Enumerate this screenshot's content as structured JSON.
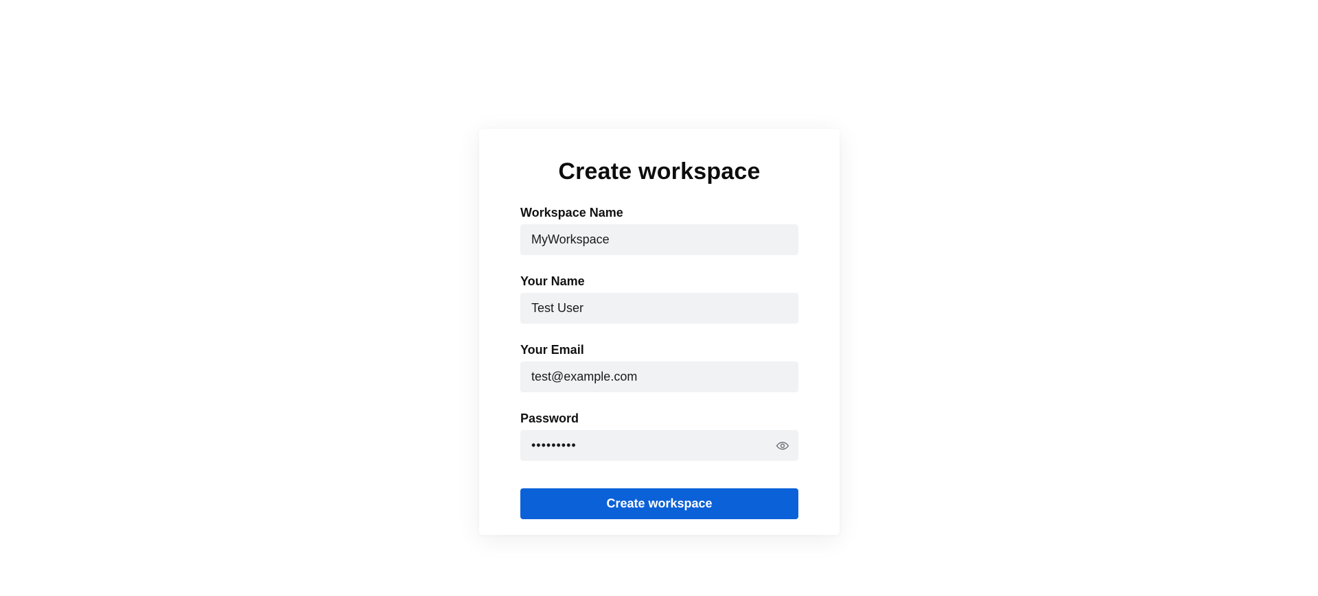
{
  "card": {
    "title": "Create workspace"
  },
  "form": {
    "workspace_name": {
      "label": "Workspace Name",
      "value": "MyWorkspace"
    },
    "your_name": {
      "label": "Your Name",
      "value": "Test User"
    },
    "your_email": {
      "label": "Your Email",
      "value": "test@example.com"
    },
    "password": {
      "label": "Password",
      "value": "•••••••••",
      "toggle_icon": "eye-icon"
    },
    "submit_label": "Create workspace"
  },
  "colors": {
    "accent": "#0b61d8",
    "input_background": "#f1f2f4",
    "text": "#111111"
  }
}
